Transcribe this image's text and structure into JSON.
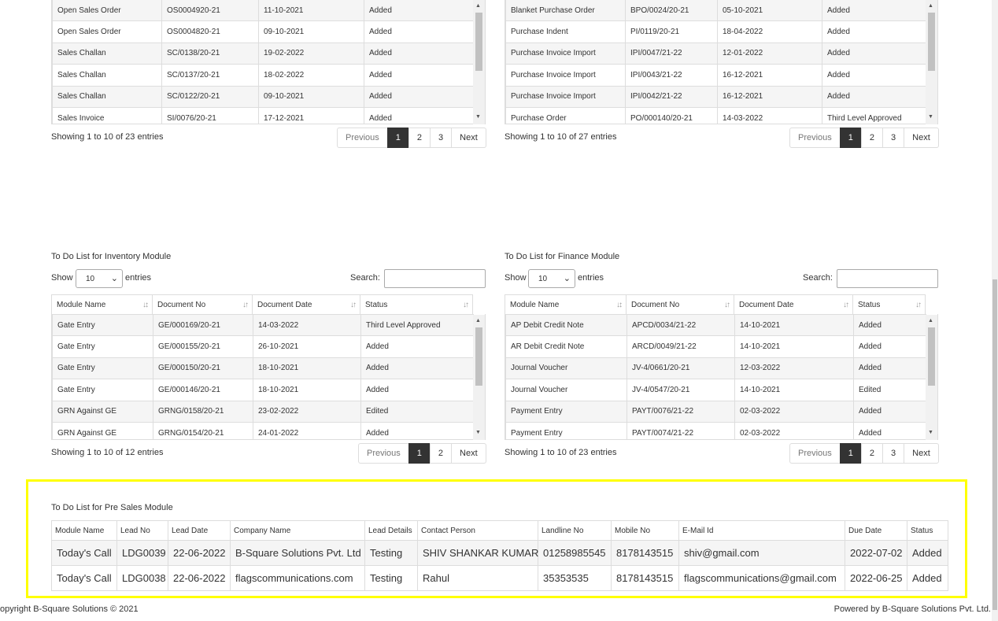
{
  "sales_panel": {
    "rows": [
      [
        "Open Sales Order",
        "OS0004920-21",
        "11-10-2021",
        "Added"
      ],
      [
        "Open Sales Order",
        "OS0004820-21",
        "09-10-2021",
        "Added"
      ],
      [
        "Sales Challan",
        "SC/0138/20-21",
        "19-02-2022",
        "Added"
      ],
      [
        "Sales Challan",
        "SC/0137/20-21",
        "18-02-2022",
        "Added"
      ],
      [
        "Sales Challan",
        "SC/0122/20-21",
        "09-10-2021",
        "Added"
      ],
      [
        "Sales Invoice",
        "SI/0076/20-21",
        "17-12-2021",
        "Added"
      ]
    ],
    "info": "Showing 1 to 10 of 23 entries",
    "pages": [
      "Previous",
      "1",
      "2",
      "3",
      "Next"
    ]
  },
  "purchase_panel": {
    "rows": [
      [
        "Blanket Purchase Order",
        "BPO/0024/20-21",
        "05-10-2021",
        "Added"
      ],
      [
        "Purchase Indent",
        "PI/0119/20-21",
        "18-04-2022",
        "Added"
      ],
      [
        "Purchase Invoice Import",
        "IPI/0047/21-22",
        "12-01-2022",
        "Added"
      ],
      [
        "Purchase Invoice Import",
        "IPI/0043/21-22",
        "16-12-2021",
        "Added"
      ],
      [
        "Purchase Invoice Import",
        "IPI/0042/21-22",
        "16-12-2021",
        "Added"
      ],
      [
        "Purchase Order",
        "PO/000140/20-21",
        "14-03-2022",
        "Third Level Approved"
      ]
    ],
    "info": "Showing 1 to 10 of 27 entries",
    "pages": [
      "Previous",
      "1",
      "2",
      "3",
      "Next"
    ]
  },
  "inventory_panel": {
    "title": "To Do List for Inventory Module",
    "show_label": "Show",
    "entries_label": "entries",
    "page_size": "10",
    "search_label": "Search:",
    "columns": [
      "Module Name",
      "Document No",
      "Document Date",
      "Status"
    ],
    "rows": [
      [
        "Gate Entry",
        "GE/000169/20-21",
        "14-03-2022",
        "Third Level Approved"
      ],
      [
        "Gate Entry",
        "GE/000155/20-21",
        "26-10-2021",
        "Added"
      ],
      [
        "Gate Entry",
        "GE/000150/20-21",
        "18-10-2021",
        "Added"
      ],
      [
        "Gate Entry",
        "GE/000146/20-21",
        "18-10-2021",
        "Added"
      ],
      [
        "GRN Against GE",
        "GRNG/0158/20-21",
        "23-02-2022",
        "Edited"
      ],
      [
        "GRN Against GE",
        "GRNG/0154/20-21",
        "24-01-2022",
        "Added"
      ]
    ],
    "info": "Showing 1 to 10 of 12 entries",
    "pages": [
      "Previous",
      "1",
      "2",
      "Next"
    ]
  },
  "finance_panel": {
    "title": "To Do List for Finance Module",
    "show_label": "Show",
    "entries_label": "entries",
    "page_size": "10",
    "search_label": "Search:",
    "columns": [
      "Module Name",
      "Document No",
      "Document Date",
      "Status"
    ],
    "rows": [
      [
        "AP Debit Credit Note",
        "APCD/0034/21-22",
        "14-10-2021",
        "Added"
      ],
      [
        "AR Debit Credit Note",
        "ARCD/0049/21-22",
        "14-10-2021",
        "Added"
      ],
      [
        "Journal Voucher",
        "JV-4/0661/20-21",
        "12-03-2022",
        "Added"
      ],
      [
        "Journal Voucher",
        "JV-4/0547/20-21",
        "14-10-2021",
        "Edited"
      ],
      [
        "Payment Entry",
        "PAYT/0076/21-22",
        "02-03-2022",
        "Added"
      ],
      [
        "Payment Entry",
        "PAYT/0074/21-22",
        "02-03-2022",
        "Added"
      ]
    ],
    "info": "Showing 1 to 10 of 23 entries",
    "pages": [
      "Previous",
      "1",
      "2",
      "3",
      "Next"
    ]
  },
  "presales": {
    "title": "To Do List for Pre Sales Module",
    "columns": [
      "Module Name",
      "Lead No",
      "Lead Date",
      "Company Name",
      "Lead Details",
      "Contact Person",
      "Landline No",
      "Mobile No",
      "E-Mail Id",
      "Due Date",
      "Status"
    ],
    "rows": [
      [
        "Today's Call",
        "LDG0039",
        "22-06-2022",
        "B-Square Solutions Pvt. Ltd",
        "Testing",
        "SHIV SHANKAR KUMAR",
        "01258985545",
        "8178143515",
        "shiv@gmail.com",
        "2022-07-02",
        "Added"
      ],
      [
        "Today's Call",
        "LDG0038",
        "22-06-2022",
        "flagscommunications.com",
        "Testing",
        "Rahul",
        "35353535",
        "8178143515",
        "flagscommunications@gmail.com",
        "2022-06-25",
        "Added"
      ]
    ]
  },
  "footer": {
    "copyright": "opyright B-Square Solutions © 2021",
    "powered": "Powered by B-Square Solutions Pvt. Ltd."
  },
  "colors": {
    "link": "#337ab7",
    "highlight": "#ffff00",
    "active_page": "#333333"
  },
  "icons": {
    "sort": "sort-icon",
    "dropdown": "chevron-down-icon",
    "scroll_up": "scroll-up-arrow-icon",
    "scroll_down": "scroll-down-arrow-icon"
  }
}
